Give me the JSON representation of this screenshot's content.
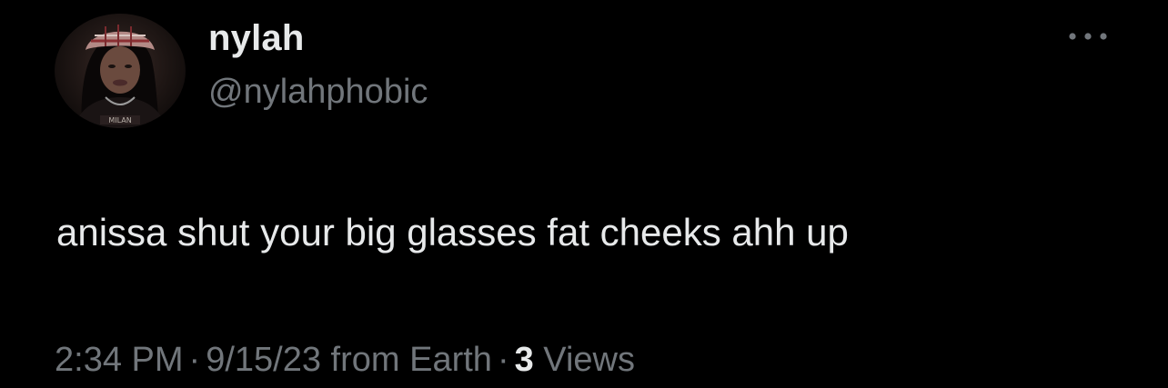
{
  "user": {
    "display_name": "nylah",
    "handle": "@nylahphobic",
    "avatar_icon": "profile-photo"
  },
  "tweet": {
    "text": "anissa shut your big glasses fat cheeks ahh up",
    "time": "2:34 PM",
    "separator": "·",
    "date": "9/15/23",
    "source": "from Earth",
    "views_count": "3",
    "views_label": "Views"
  },
  "menu": {
    "icon": "more-horizontal-icon"
  },
  "colors": {
    "background": "#000000",
    "primary_text": "#e7e9ea",
    "secondary_text": "#71767b"
  }
}
